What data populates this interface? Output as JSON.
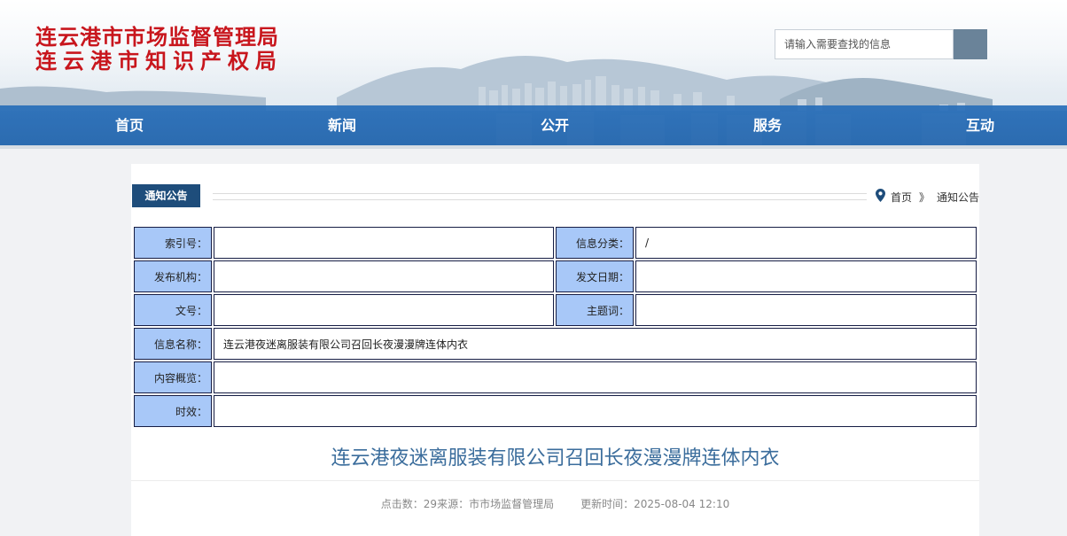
{
  "header": {
    "title_line1": "连云港市市场监督管理局",
    "title_line2": "连云港市知识产权局",
    "search_placeholder": "请输入需要查找的信息",
    "search_button_icon": "search-icon"
  },
  "nav": {
    "items": [
      "首页",
      "新闻",
      "公开",
      "服务",
      "互动"
    ]
  },
  "section": {
    "tab_label": "通知公告",
    "breadcrumb": {
      "icon": "location-pin-icon",
      "home": "首页",
      "separator": "》",
      "current": "通知公告"
    }
  },
  "info_table": {
    "index_label": "索引号：",
    "index_value": "",
    "category_label": "信息分类：",
    "category_value": "/",
    "publisher_label": "发布机构：",
    "publisher_value": "",
    "date_label": "发文日期：",
    "date_value": "",
    "doc_no_label": "文号：",
    "doc_no_value": "",
    "keywords_label": "主题词：",
    "keywords_value": "",
    "name_label": "信息名称：",
    "name_value": "连云港夜迷离服装有限公司召回长夜漫漫牌连体内衣",
    "summary_label": "内容概览：",
    "summary_value": "",
    "validity_label": "时效：",
    "validity_value": ""
  },
  "article": {
    "title": "连云港夜迷离服装有限公司召回长夜漫漫牌连体内衣",
    "meta_clicks": "点击数：29",
    "meta_source": "来源：市市场监督管理局",
    "meta_updated": "更新时间：2025-08-04 12:10"
  },
  "colors": {
    "title_red": "#c8161d",
    "nav_blue": "#2a6fb8",
    "tab_navy": "#1e4d7b",
    "table_key_bg": "#a8c8f8",
    "article_title": "#3b6d9c"
  }
}
